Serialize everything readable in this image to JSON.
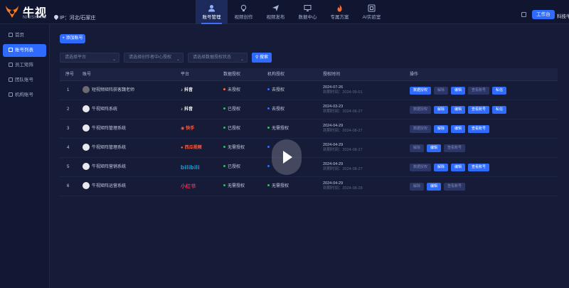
{
  "app": {
    "brand": "牛视",
    "brand_sub": "NIUSHI4.0",
    "ip": "IP：河北/石家庄",
    "workbench_label": "工作台",
    "user_name": "科技牛"
  },
  "nav": [
    {
      "label": "账号管理",
      "icon": "user-icon",
      "active": true
    },
    {
      "label": "视频创作",
      "icon": "bulb-icon",
      "active": false
    },
    {
      "label": "视频发布",
      "icon": "send-icon",
      "active": false
    },
    {
      "label": "数据中心",
      "icon": "monitor-icon",
      "active": false
    },
    {
      "label": "专属方案",
      "icon": "flame-icon",
      "active": false
    },
    {
      "label": "AI实验室",
      "icon": "grid-icon",
      "active": false
    }
  ],
  "sidebar": [
    {
      "label": "首页",
      "active": false
    },
    {
      "label": "账号列表",
      "active": true
    },
    {
      "label": "员工矩阵",
      "active": false
    },
    {
      "label": "团队账号",
      "active": false
    },
    {
      "label": "机构账号",
      "active": false
    }
  ],
  "toolbar": {
    "add_label": "+ 添加账号",
    "filters": [
      "请选择平台",
      "请选择创作者中心授权",
      "请选择数据授权状态"
    ],
    "search_label": "搜索"
  },
  "table": {
    "headers": [
      "序号",
      "账号",
      "平台",
      "数据授权",
      "机构授权",
      "授权时间",
      "操作"
    ],
    "rows": [
      {
        "no": "1",
        "account": "短视频矩阵获客魏老师",
        "avatar": "photo",
        "platform": "抖音",
        "platform_key": "douyin",
        "data_auth": "未授权",
        "data_color": "#ff6a3d",
        "org_auth": "去授权",
        "org_color": "#2f6bff",
        "time": "2024-07-26",
        "expire": "到期时间：2024-09-01",
        "ops": [
          {
            "label": "数据授权",
            "style": "primary"
          },
          {
            "label": "解除",
            "style": "muted"
          },
          {
            "label": "编辑",
            "style": "primary"
          },
          {
            "label": "查看账号",
            "style": "muted"
          },
          {
            "label": "私信",
            "style": "primary"
          }
        ]
      },
      {
        "no": "2",
        "account": "牛视矩阵系统",
        "avatar": "logo",
        "platform": "抖音",
        "platform_key": "douyin",
        "data_auth": "已授权",
        "data_color": "#2fc25b",
        "org_auth": "去授权",
        "org_color": "#2f6bff",
        "time": "2024-03-23",
        "expire": "到期时间：2024-06-27",
        "ops": [
          {
            "label": "数据授权",
            "style": "muted"
          },
          {
            "label": "解除",
            "style": "primary"
          },
          {
            "label": "编辑",
            "style": "primary"
          },
          {
            "label": "查看账号",
            "style": "primary"
          },
          {
            "label": "私信",
            "style": "primary"
          }
        ]
      },
      {
        "no": "3",
        "account": "牛视矩阵管理系统",
        "avatar": "logo",
        "platform": "快手",
        "platform_key": "kuaishou",
        "data_auth": "已授权",
        "data_color": "#2fc25b",
        "org_auth": "无需授权",
        "org_color": "#2fc25b",
        "time": "2024-04-29",
        "expire": "到期时间：2024-08-27",
        "ops": [
          {
            "label": "数据授权",
            "style": "muted"
          },
          {
            "label": "解除",
            "style": "primary"
          },
          {
            "label": "编辑",
            "style": "primary"
          },
          {
            "label": "查看账号",
            "style": "primary"
          }
        ]
      },
      {
        "no": "4",
        "account": "牛视矩阵管理系统",
        "avatar": "logo",
        "platform": "西瓜视频",
        "platform_key": "xigua",
        "data_auth": "无需授权",
        "data_color": "#2fc25b",
        "org_auth": "",
        "org_color": "#2f6bff",
        "time": "2024-04-29",
        "expire": "到期时间：2024-08-27",
        "ops": [
          {
            "label": "解除",
            "style": "muted"
          },
          {
            "label": "编辑",
            "style": "primary"
          },
          {
            "label": "查看账号",
            "style": "muted"
          }
        ]
      },
      {
        "no": "5",
        "account": "牛视矩阵营销系统",
        "avatar": "logo",
        "platform": "bilibili",
        "platform_key": "bili",
        "data_auth": "已授权",
        "data_color": "#2fc25b",
        "org_auth": "",
        "org_color": "#2f6bff",
        "time": "2024-04-29",
        "expire": "到期时间：2024-08-27",
        "ops": [
          {
            "label": "数据授权",
            "style": "muted"
          },
          {
            "label": "解除",
            "style": "primary"
          },
          {
            "label": "编辑",
            "style": "primary"
          },
          {
            "label": "查看账号",
            "style": "primary"
          }
        ]
      },
      {
        "no": "6",
        "account": "牛视矩阵运营系统",
        "avatar": "logo",
        "platform": "小红书",
        "platform_key": "xhs",
        "data_auth": "无需授权",
        "data_color": "#2fc25b",
        "org_auth": "无需授权",
        "org_color": "#2fc25b",
        "time": "2024-04-29",
        "expire": "到期时间：2024-08-28",
        "ops": [
          {
            "label": "解除",
            "style": "muted"
          },
          {
            "label": "编辑",
            "style": "primary"
          },
          {
            "label": "查看账号",
            "style": "muted"
          }
        ]
      }
    ]
  },
  "video": {
    "icon": "play-icon"
  }
}
